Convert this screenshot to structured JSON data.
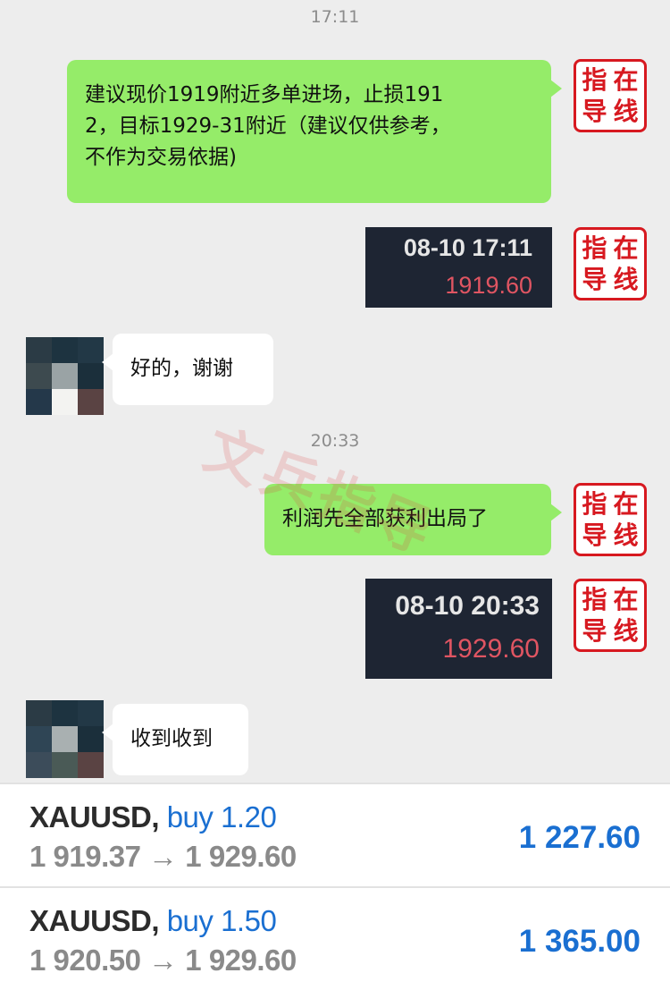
{
  "chat": {
    "time1": "17:11",
    "msg1": "建议现价1919附近多单进场，止损1912，目标1929-31附近（建议仅供参考，不作为交易依据)",
    "msg1_lines": [
      "建议现价1919附近多单进场，止损191",
      "2，目标1929-31附近（建议仅供参考，",
      "不作为交易依据)"
    ],
    "quote1": {
      "time": "08-10 17:11",
      "price": "1919.60"
    },
    "reply1": "好的，谢谢",
    "time2": "20:33",
    "msg2": "利润先全部获利出局了",
    "quote2": {
      "time": "08-10 20:33",
      "price": "1929.60"
    },
    "reply2": "收到收到",
    "stamp_chars": [
      "指",
      "在",
      "导",
      "线"
    ],
    "watermark": "文兵指导"
  },
  "trades": [
    {
      "symbol": "XAUUSD,",
      "side": "buy 1.20",
      "route": "1 919.37 → 1 929.60",
      "profit": "1 227.60"
    },
    {
      "symbol": "XAUUSD,",
      "side": "buy 1.50",
      "route": "1 920.50 → 1 929.60",
      "profit": "1 365.00"
    }
  ],
  "colors": {
    "bubble_mine": "#95ec69",
    "stamp_red": "#d71920",
    "buy_blue": "#1a6fd1",
    "quote_price_red": "#e05562"
  }
}
